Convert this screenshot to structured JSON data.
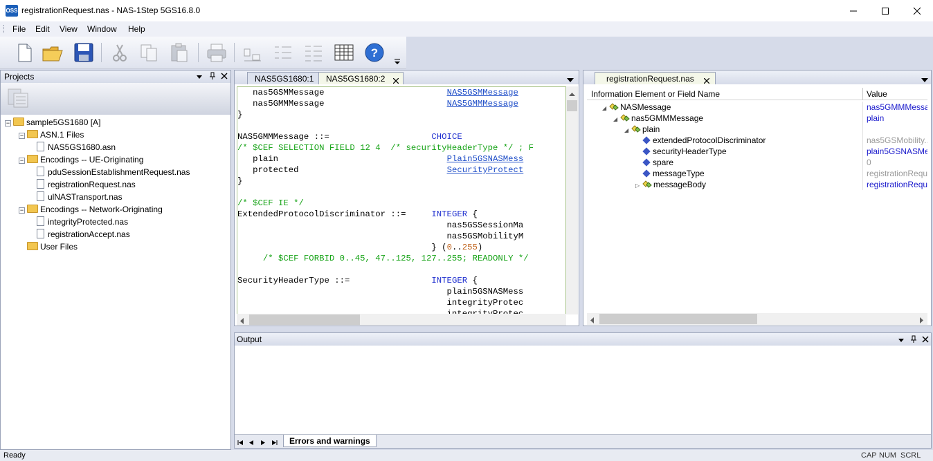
{
  "window": {
    "title": "registrationRequest.nas  -  NAS-1Step 5GS16.8.0",
    "app_icon_text": "OSS"
  },
  "menu": [
    "File",
    "Edit",
    "View",
    "Window",
    "Help"
  ],
  "toolbar_icons": [
    "new-file-icon",
    "open-folder-icon",
    "save-icon",
    "cut-icon",
    "copy-icon",
    "paste-icon",
    "print-icon",
    "encode-icon",
    "decode-icon",
    "tree-icon",
    "table-icon",
    "help-icon"
  ],
  "projects": {
    "title": "Projects",
    "tree": [
      {
        "label": "sample5GS1680 [A]",
        "kind": "folder",
        "level": 0
      },
      {
        "label": "ASN.1 Files",
        "kind": "folder",
        "level": 1
      },
      {
        "label": "NAS5GS1680.asn",
        "kind": "file",
        "level": 2
      },
      {
        "label": "Encodings -- UE-Originating",
        "kind": "folder",
        "level": 1
      },
      {
        "label": "pduSessionEstablishmentRequest.nas",
        "kind": "file",
        "level": 2
      },
      {
        "label": "registrationRequest.nas",
        "kind": "file",
        "level": 2
      },
      {
        "label": "ulNASTransport.nas",
        "kind": "file",
        "level": 2
      },
      {
        "label": "Encodings -- Network-Originating",
        "kind": "folder",
        "level": 1
      },
      {
        "label": "integrityProtected.nas",
        "kind": "file",
        "level": 2
      },
      {
        "label": "registrationAccept.nas",
        "kind": "file",
        "level": 2
      },
      {
        "label": "User Files",
        "kind": "folder",
        "level": 1
      }
    ]
  },
  "editor": {
    "tabs": [
      "NAS5GS1680:1",
      "NAS5GS1680:2"
    ],
    "active_tab": "NAS5GS1680:2",
    "lines": [
      [
        {
          "t": "tx",
          "v": "   nas5GSMMessage                        "
        },
        {
          "t": "link",
          "v": "NAS5GSMMessage"
        }
      ],
      [
        {
          "t": "tx",
          "v": "   nas5GMMMessage                        "
        },
        {
          "t": "link",
          "v": "NAS5GMMMessage"
        }
      ],
      [
        {
          "t": "tx",
          "v": "}"
        }
      ],
      [
        {
          "t": "tx",
          "v": ""
        }
      ],
      [
        {
          "t": "tx",
          "v": "NAS5GMMMessage ::=                    "
        },
        {
          "t": "kw",
          "v": "CHOICE"
        }
      ],
      [
        {
          "t": "cm",
          "v": "/* $CEF SELECTION FIELD 12 4  /* securityHeaderType */ ; F"
        }
      ],
      [
        {
          "t": "tx",
          "v": "   plain                                 "
        },
        {
          "t": "link",
          "v": "Plain5GSNASMess"
        }
      ],
      [
        {
          "t": "tx",
          "v": "   protected                             "
        },
        {
          "t": "link",
          "v": "SecurityProtect"
        }
      ],
      [
        {
          "t": "tx",
          "v": "}"
        }
      ],
      [
        {
          "t": "tx",
          "v": ""
        }
      ],
      [
        {
          "t": "cm",
          "v": "/* $CEF IE */"
        }
      ],
      [
        {
          "t": "tx",
          "v": "ExtendedProtocolDiscriminator ::=     "
        },
        {
          "t": "kw",
          "v": "INTEGER"
        },
        {
          "t": "tx",
          "v": " {"
        }
      ],
      [
        {
          "t": "tx",
          "v": "                                         nas5GSSessionMa"
        }
      ],
      [
        {
          "t": "tx",
          "v": "                                         nas5GSMobilityM"
        }
      ],
      [
        {
          "t": "tx",
          "v": "                                      } ("
        },
        {
          "t": "num",
          "v": "0"
        },
        {
          "t": "tx",
          "v": ".."
        },
        {
          "t": "num",
          "v": "255"
        },
        {
          "t": "tx",
          "v": ")"
        }
      ],
      [
        {
          "t": "cm",
          "v": "     /* $CEF FORBID 0..45, 47..125, 127..255; READONLY */"
        }
      ],
      [
        {
          "t": "tx",
          "v": ""
        }
      ],
      [
        {
          "t": "tx",
          "v": "SecurityHeaderType ::=                "
        },
        {
          "t": "kw",
          "v": "INTEGER"
        },
        {
          "t": "tx",
          "v": " {"
        }
      ],
      [
        {
          "t": "tx",
          "v": "                                         plain5GSNASMess"
        }
      ],
      [
        {
          "t": "tx",
          "v": "                                         integrityProtec"
        }
      ],
      [
        {
          "t": "tx",
          "v": "                                         integrityProtec"
        }
      ]
    ]
  },
  "ie_pane": {
    "tab": "registrationRequest.nas",
    "col_name": "Information Element or Field Name",
    "col_value": "Value",
    "rows": [
      {
        "name": "NASMessage",
        "level": 0,
        "icon": "seq",
        "value": "nas5GMMMessa",
        "vcolor": "#1a1acc",
        "expander": "open"
      },
      {
        "name": "nas5GMMMessage",
        "level": 1,
        "icon": "seq",
        "value": "plain",
        "vcolor": "#1a1acc",
        "expander": "open"
      },
      {
        "name": "plain",
        "level": 2,
        "icon": "seq",
        "value": "",
        "vcolor": "#1a1acc",
        "expander": "open"
      },
      {
        "name": "extendedProtocolDiscriminator",
        "level": 3,
        "icon": "leaf",
        "value": "nas5GSMobility...",
        "vcolor": "#9a9a9a",
        "expander": ""
      },
      {
        "name": "securityHeaderType",
        "level": 3,
        "icon": "leaf",
        "value": "plain5GSNASMe",
        "vcolor": "#1a1acc",
        "expander": ""
      },
      {
        "name": "spare",
        "level": 3,
        "icon": "leaf",
        "value": "0",
        "vcolor": "#9a9a9a",
        "expander": ""
      },
      {
        "name": "messageType",
        "level": 3,
        "icon": "leaf",
        "value": "registrationRequ",
        "vcolor": "#9a9a9a",
        "expander": ""
      },
      {
        "name": "messageBody",
        "level": 3,
        "icon": "seq",
        "value": "registrationRequ",
        "vcolor": "#1a1acc",
        "expander": "closed"
      }
    ]
  },
  "output": {
    "title": "Output",
    "tab": "Errors and warnings"
  },
  "status": {
    "text": "Ready",
    "cap": "CAP",
    "num": "NUM",
    "scrl": "SCRL"
  }
}
